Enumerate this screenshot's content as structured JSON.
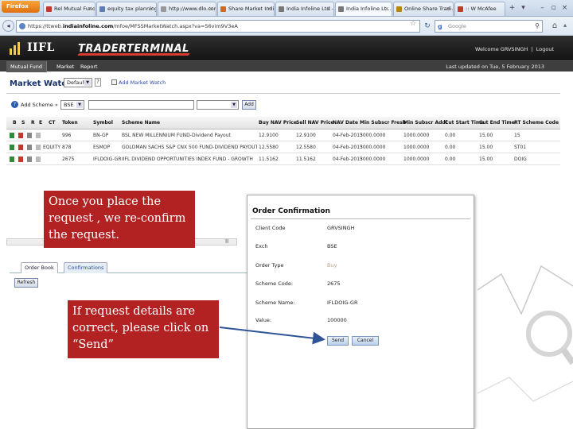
{
  "browser": {
    "menu_label": "Firefox",
    "tabs": [
      {
        "title": "Rel Mutual Fund -...",
        "active": false
      },
      {
        "title": "equity tax planning...",
        "active": false
      },
      {
        "title": "http://www.dlo.com/",
        "active": false
      },
      {
        "title": "Share Market Indic...",
        "active": false
      },
      {
        "title": "India Infoline Ltd -...",
        "active": false
      },
      {
        "title": "India Infoline Lt...",
        "active": true
      },
      {
        "title": "Online Share Tradi...",
        "active": false
      },
      {
        "title": ":: W McAfee",
        "active": false
      }
    ],
    "url_prefix": "https://ttweb.",
    "url_domain": "indiainfoline.com",
    "url_suffix": "/mfoe/MFSSMarketWatch.aspx?va=56vim9V3eA",
    "search_engine": "Google",
    "search_placeholder": "Google"
  },
  "site": {
    "logo_text": "IIFL",
    "product_name": "TRADERTERMINAL",
    "welcome_text": "Welcome GRVSINGH",
    "logout_label": "Logout",
    "menu": [
      "Mutual Fund",
      "Market",
      "Report"
    ],
    "last_updated": "Last updated on Tue, 5 February 2013"
  },
  "market_watch": {
    "title": "Market Watch",
    "watchlist_selected": "Default",
    "help_label": "?",
    "add_watch_label": "Add Market Watch",
    "add_scheme_label": "Add Scheme »",
    "exchange_selected": "BSE",
    "scheme_input_value": "",
    "add_button_label": "Add",
    "columns": [
      "B",
      "S",
      "R",
      "E",
      "CT",
      "Token",
      "Symbol",
      "Scheme Name",
      "Buy NAV Price",
      "Sell NAV Price",
      "NAV Date",
      "Min Subscr Fresh",
      "Min Subscr Addl",
      "Cut Start Time",
      "Cut End Time",
      "RT Scheme Code"
    ],
    "rows": [
      [
        "",
        "",
        "",
        "",
        "",
        "996",
        "BN-GP",
        "BSL NEW MILLENNIUM FUND-Dividend Payout",
        "12.9100",
        "12.9100",
        "04-Feb-2013",
        "5000.0000",
        "1000.0000",
        "0.00",
        "15.00",
        "15"
      ],
      [
        "",
        "",
        "",
        "",
        "EQUITY",
        "878",
        "ESMOP",
        "GOLDMAN SACHS S&P CNX 500 FUND-DIVIDEND PAYOUT OPTION",
        "12.5580",
        "12.5580",
        "04-Feb-2013",
        "5000.0000",
        "1000.0000",
        "0.00",
        "15.00",
        "ST01"
      ],
      [
        "",
        "",
        "",
        "",
        "",
        "2675",
        "IFLDOIG-GR",
        "IIFL DIVIDEND OPPORTUNITIES INDEX FUND - GROWTH",
        "11.5162",
        "11.5162",
        "04-Feb-2013",
        "5000.0000",
        "1000.0000",
        "0.00",
        "15.00",
        "DOIG"
      ]
    ]
  },
  "bottom": {
    "tabs": [
      "Order Book",
      "Confirmations"
    ],
    "refresh_label": "Refresh",
    "scroll_mark": "II"
  },
  "dialog": {
    "title": "Order Confirmation",
    "fields": [
      {
        "label": "Client Code",
        "value": "GRVSINGH"
      },
      {
        "label": "Exch",
        "value": "BSE"
      },
      {
        "label": "Order Type",
        "value": "Buy"
      },
      {
        "label": "Scheme Code:",
        "value": "2675"
      },
      {
        "label": "Scheme Name:",
        "value": "IFLDOIG-GR"
      },
      {
        "label": "Value:",
        "value": "100000"
      }
    ],
    "send_label": "Send",
    "cancel_label": "Cancel"
  },
  "callouts": {
    "first": "Once you place the request , we re-confirm the request.",
    "second": "If request details are correct, please click on “Send”"
  },
  "colors": {
    "callout_bg": "#b22222",
    "header_bg": "#1f1f1f",
    "accent_red": "#d63d2e",
    "link_blue": "#2a4aa0"
  }
}
